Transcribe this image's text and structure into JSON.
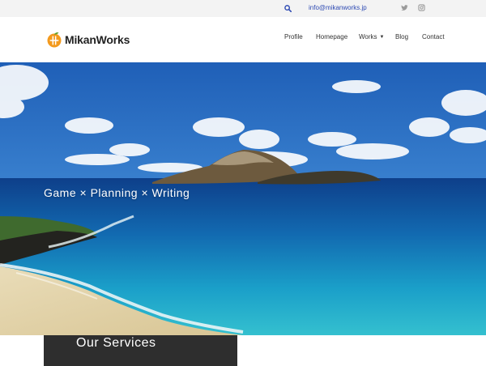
{
  "topbar": {
    "email": "info@mikanworks.jp",
    "icons": [
      "search-icon",
      "twitter-icon",
      "instagram-icon"
    ]
  },
  "brand": {
    "name": "MikanWorks",
    "logo_color": "#f39a1e"
  },
  "nav": {
    "items": [
      {
        "label": "Profile"
      },
      {
        "label": "Homepage"
      },
      {
        "label": "Works",
        "has_dropdown": true
      },
      {
        "label": "Blog"
      },
      {
        "label": "Contact"
      }
    ]
  },
  "hero": {
    "tagline": "Game × Planning × Writing"
  },
  "services": {
    "title": "Our Services"
  },
  "colors": {
    "accent": "#f39a1e",
    "link": "#2f4bb3",
    "topbar_bg": "#f3f3f3",
    "services_bg": "#2e2e2e"
  }
}
